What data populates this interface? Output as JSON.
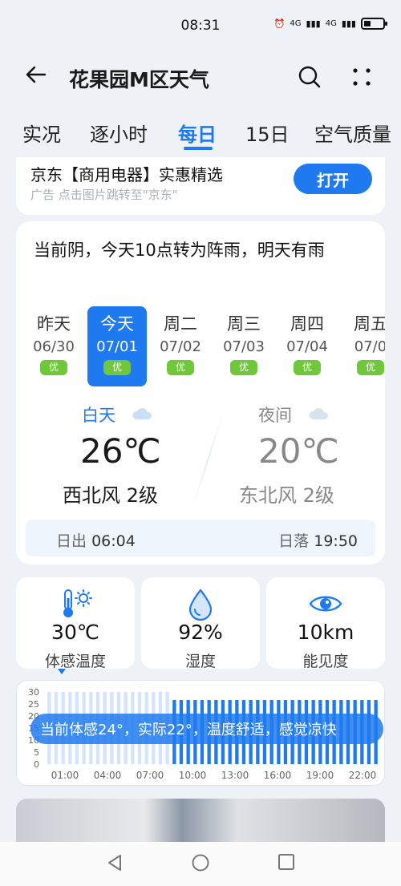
{
  "status": {
    "time": "08:31",
    "signal1": "4G",
    "signal2": "4G"
  },
  "header": {
    "title": "花果园M区天气"
  },
  "tabs": [
    {
      "label": "实况"
    },
    {
      "label": "逐小时"
    },
    {
      "label": "每日"
    },
    {
      "label": "15日"
    },
    {
      "label": "空气质量"
    }
  ],
  "active_tab": "每日",
  "ad": {
    "title": "京东【商用电器】实惠精选",
    "subtitle": "广告 点击图片跳转至\"京东\"",
    "button": "打开"
  },
  "summary": "当前阴，今天10点转为阵雨，明天有雨",
  "days": [
    {
      "name": "昨天",
      "date": "06/30",
      "aqi": "优"
    },
    {
      "name": "今天",
      "date": "07/01",
      "aqi": "优"
    },
    {
      "name": "周二",
      "date": "07/02",
      "aqi": "优"
    },
    {
      "name": "周三",
      "date": "07/03",
      "aqi": "优"
    },
    {
      "name": "周四",
      "date": "07/04",
      "aqi": "优"
    },
    {
      "name": "周五",
      "date": "07/0",
      "aqi": "优"
    }
  ],
  "daytime": {
    "label": "白天",
    "temp": "26℃",
    "wind": "西北风 2级"
  },
  "night": {
    "label": "夜间",
    "temp": "20℃",
    "wind": "东北风 2级"
  },
  "sun": {
    "sunrise_label": "日出",
    "sunrise": "06:04",
    "sunset_label": "日落",
    "sunset": "19:50"
  },
  "stats": [
    {
      "value": "30℃",
      "label": "体感温度",
      "icon": "thermometer-sun-icon"
    },
    {
      "value": "92%",
      "label": "湿度",
      "icon": "water-drop-icon"
    },
    {
      "value": "10km",
      "label": "能见度",
      "icon": "eye-icon"
    }
  ],
  "chart_data": {
    "type": "bar",
    "y_ticks": [
      "30",
      "25",
      "20",
      "15",
      "10",
      "5",
      "0"
    ],
    "x_ticks": [
      "01:00",
      "04:00",
      "07:00",
      "10:00",
      "13:00",
      "16:00",
      "19:00",
      "22:00"
    ],
    "ylim": [
      0,
      30
    ],
    "tooltip": "当前体感24°，实际22°，温度舒适，感觉凉快",
    "colors": {
      "past": "#d4e5fb",
      "future": "#1f7af0"
    }
  },
  "colors": {
    "accent": "#1f7af0",
    "aqi_good": "#6fc73a"
  }
}
